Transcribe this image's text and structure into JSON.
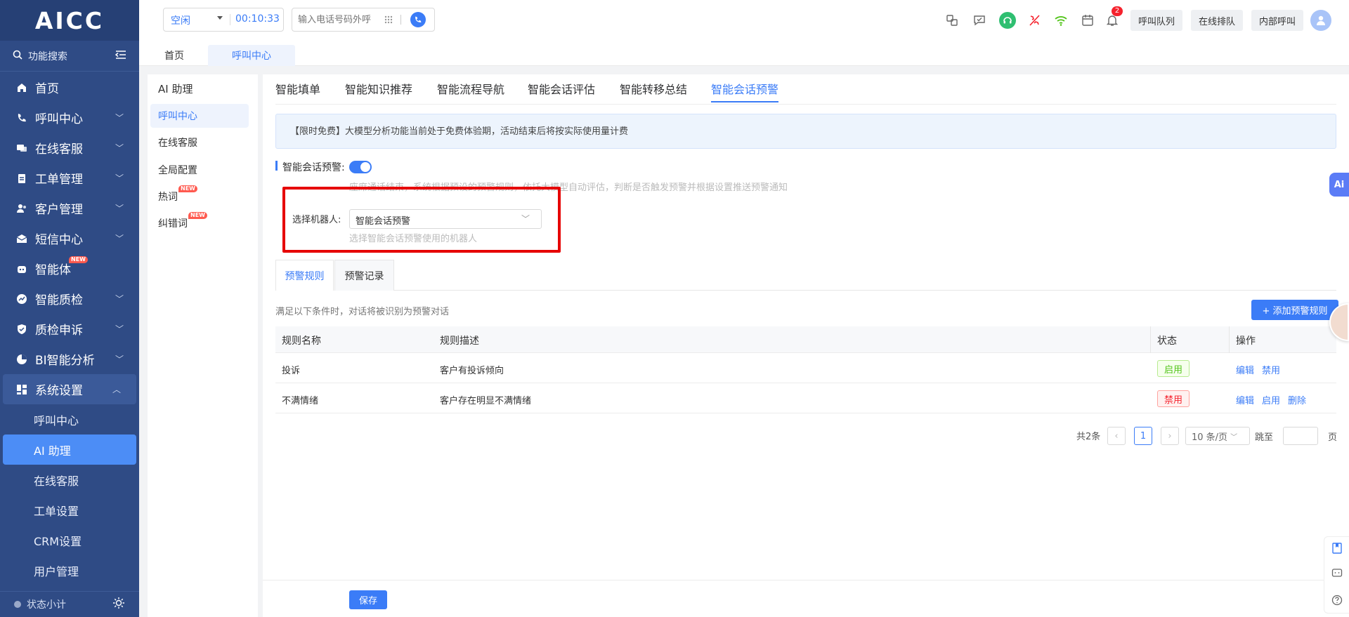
{
  "app": {
    "logo": "AICC"
  },
  "sidebar": {
    "search_label": "功能搜索",
    "items": [
      {
        "label": "首页",
        "icon": "home-icon"
      },
      {
        "label": "呼叫中心",
        "icon": "phone-icon"
      },
      {
        "label": "在线客服",
        "icon": "chat-icon"
      },
      {
        "label": "工单管理",
        "icon": "clipboard-icon"
      },
      {
        "label": "客户管理",
        "icon": "users-icon"
      },
      {
        "label": "短信中心",
        "icon": "mail-icon"
      },
      {
        "label": "智能体",
        "icon": "robot-icon",
        "badge": "NEW"
      },
      {
        "label": "智能质检",
        "icon": "chart-icon"
      },
      {
        "label": "质检申诉",
        "icon": "shield-icon"
      },
      {
        "label": "BI智能分析",
        "icon": "pie-icon"
      },
      {
        "label": "系统设置",
        "icon": "grid-icon"
      }
    ],
    "subitems": [
      "呼叫中心",
      "AI 助理",
      "在线客服",
      "工单设置",
      "CRM设置",
      "用户管理"
    ],
    "footer_label": "状态小计"
  },
  "topbar": {
    "status": "空闲",
    "timer": "00:10:33",
    "dial_placeholder": "输入电话号码外呼",
    "notification_count": "2",
    "buttons": [
      "呼叫队列",
      "在线排队",
      "内部呼叫"
    ]
  },
  "tabs": {
    "items": [
      "首页",
      "呼叫中心"
    ],
    "active": 1
  },
  "left_panel": {
    "title": "AI 助理",
    "items": [
      {
        "label": "呼叫中心"
      },
      {
        "label": "在线客服"
      },
      {
        "label": "全局配置"
      },
      {
        "label": "热词",
        "badge": "NEW"
      },
      {
        "label": "纠错词",
        "badge": "NEW"
      }
    ]
  },
  "feature_tabs": [
    "智能填单",
    "智能知识推荐",
    "智能流程导航",
    "智能会话评估",
    "智能转移总结",
    "智能会话预警"
  ],
  "notice": "【限时免费】大模型分析功能当前处于免费体验期，活动结束后将按实际使用量计费",
  "toggle": {
    "label": "智能会话预警:",
    "hint": "座席通话结束，系统根据预设的预警规则，依托大模型自动评估，判断是否触发预警并根据设置推送预警通知"
  },
  "robot": {
    "label": "选择机器人:",
    "value": "智能会话预警",
    "hint": "选择智能会话预警使用的机器人"
  },
  "subtabs": [
    "预警规则",
    "预警记录"
  ],
  "rules": {
    "desc": "满足以下条件时，对话将被识别为预警对话",
    "add_label": "+ 添加预警规则",
    "columns": [
      "规则名称",
      "规则描述",
      "状态",
      "操作"
    ],
    "rows": [
      {
        "name": "投诉",
        "desc": "客户有投诉倾向",
        "status": "启用",
        "actions": [
          "编辑",
          "禁用"
        ]
      },
      {
        "name": "不满情绪",
        "desc": "客户存在明显不满情绪",
        "status": "禁用",
        "actions": [
          "编辑",
          "启用",
          "删除"
        ]
      }
    ]
  },
  "pagination": {
    "total": "共2条",
    "page": "1",
    "page_size": "10 条/页",
    "goto": "跳至",
    "unit": "页"
  },
  "save_label": "保存",
  "colors": {
    "sidebar": "#2f4b85",
    "accent": "#3b7cf7",
    "highlight": "#e60000",
    "enabled": "#52c41a",
    "disabled": "#f5222d"
  }
}
